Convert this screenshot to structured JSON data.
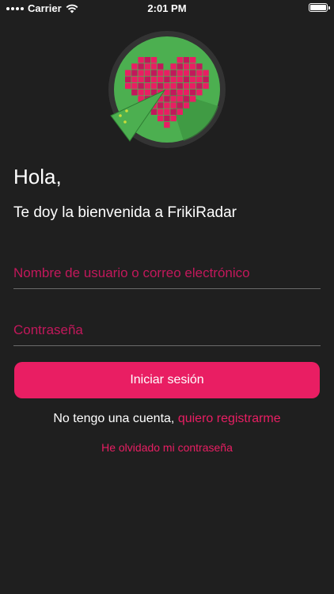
{
  "status_bar": {
    "carrier": "Carrier",
    "time": "2:01 PM"
  },
  "logo": {
    "name": "frikiradar-logo",
    "colors": {
      "green": "#4caf50",
      "dark_green": "#2e7d32",
      "pink": "#e91e63",
      "ring": "#333333"
    }
  },
  "greeting": "Hola,",
  "welcome": "Te doy la bienvenida a FrikiRadar",
  "username_field": {
    "placeholder": "Nombre de usuario o correo electrónico",
    "value": ""
  },
  "password_field": {
    "placeholder": "Contraseña",
    "value": ""
  },
  "login_button": "Iniciar sesión",
  "register": {
    "prefix": "No tengo una cuenta, ",
    "link": "quiero registrarme"
  },
  "forgot_password": "He olvidado mi contraseña",
  "colors": {
    "background": "#1f1f1f",
    "accent": "#e91e63",
    "text": "#ffffff"
  }
}
